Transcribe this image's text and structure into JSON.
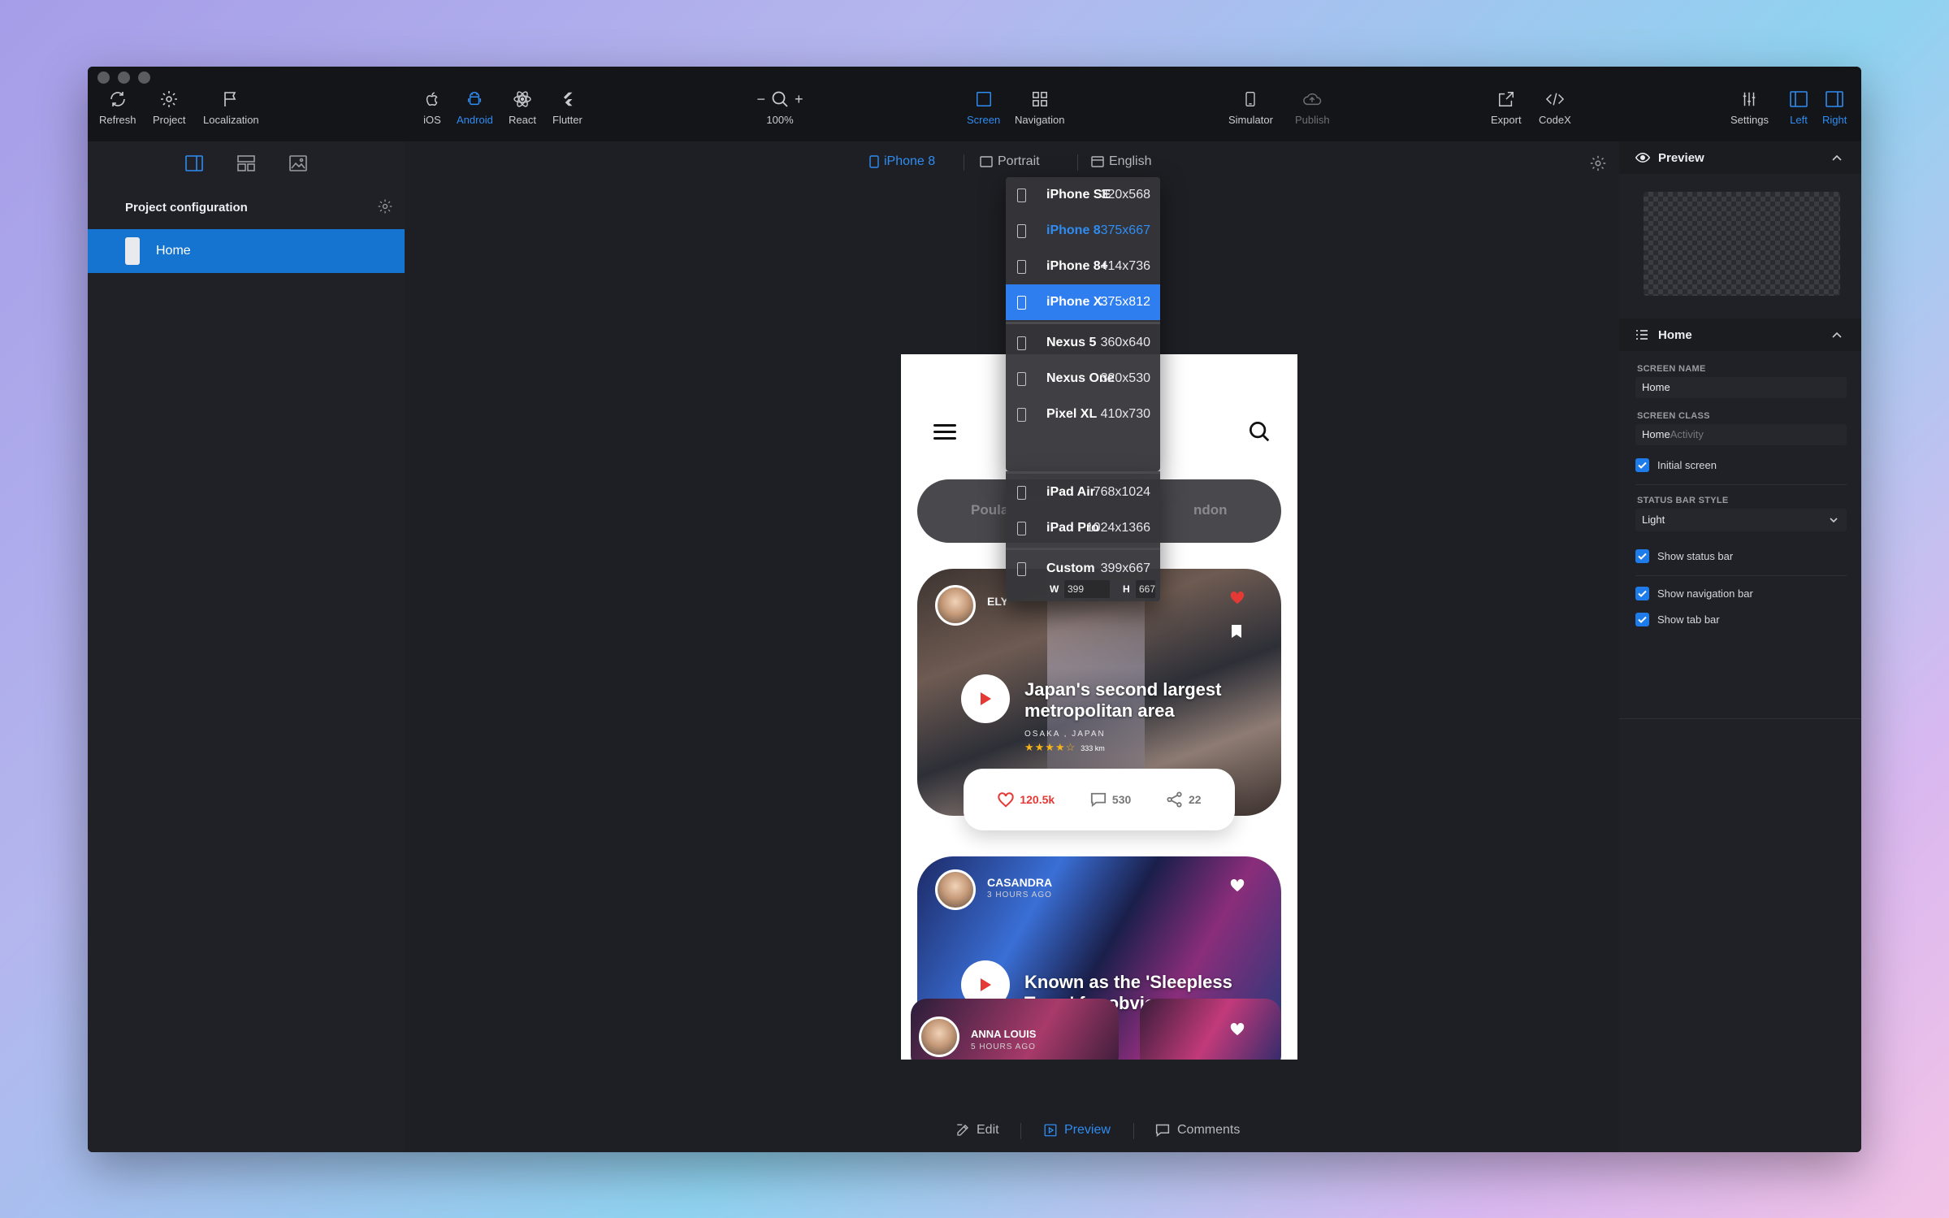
{
  "toolbar": {
    "refresh": "Refresh",
    "project": "Project",
    "localization": "Localization",
    "ios": "iOS",
    "android": "Android",
    "react": "React",
    "flutter": "Flutter",
    "zoom": "100%",
    "screen": "Screen",
    "navigation": "Navigation",
    "simulator": "Simulator",
    "publish": "Publish",
    "export": "Export",
    "codex": "CodeX",
    "settings": "Settings",
    "left": "Left",
    "right": "Right"
  },
  "left_panel": {
    "section_title": "Project configuration",
    "screens": [
      {
        "label": "Home",
        "selected": true
      }
    ]
  },
  "canvas": {
    "device": "iPhone 8",
    "orientation": "Portrait",
    "language": "English",
    "bottom_tabs": {
      "edit": "Edit",
      "preview": "Preview",
      "comments": "Comments"
    }
  },
  "device_menu": {
    "items": [
      {
        "name": "iPhone SE",
        "res": "320x568"
      },
      {
        "name": "iPhone 8",
        "res": "375x667",
        "current": true
      },
      {
        "name": "iPhone 8+",
        "res": "414x736"
      },
      {
        "name": "iPhone X",
        "res": "375x812",
        "selected": true
      },
      {
        "name": "Nexus 5",
        "res": "360x640"
      },
      {
        "name": "Nexus One",
        "res": "320x530"
      },
      {
        "name": "Pixel XL",
        "res": "410x730"
      },
      {
        "name": "iPad Air",
        "res": "768x1024"
      },
      {
        "name": "iPad Pro",
        "res": "1024x1366"
      },
      {
        "name": "Custom",
        "res": "399x667"
      }
    ],
    "custom_w_label": "W",
    "custom_h_label": "H",
    "custom_w": "399",
    "custom_h": "667"
  },
  "phone": {
    "segment_left": "Poula",
    "segment_right": "ndon",
    "card1": {
      "author": "ELY",
      "title_line1": "Japan's second largest",
      "title_line2": "metropolitan area",
      "location": "OSAKA , JAPAN",
      "stars": "★★★★☆",
      "distance": "333 km",
      "likes": "120.5k",
      "comments": "530",
      "shares": "22"
    },
    "card2": {
      "author": "CASANDRA",
      "time": "3 HOURS AGO",
      "title_line1": "Known as the 'Sleepless",
      "title_line2": "Town' for obvious reas"
    },
    "card3": {
      "author": "ANNA LOUIS",
      "time": "5 HOURS AGO"
    }
  },
  "right_panel": {
    "preview_title": "Preview",
    "home_title": "Home",
    "screen_name_label": "SCREEN NAME",
    "screen_name_value": "Home",
    "screen_class_label": "SCREEN CLASS",
    "screen_class_value": "Home",
    "screen_class_suffix": "Activity",
    "initial_screen": "Initial screen",
    "status_bar_style_label": "STATUS BAR STYLE",
    "status_bar_style_value": "Light",
    "show_status_bar": "Show status bar",
    "show_navigation_bar": "Show navigation bar",
    "show_tab_bar": "Show tab bar"
  },
  "colors": {
    "accent": "#2f8cf2",
    "selection": "#1474cf",
    "heart": "#e53935"
  }
}
